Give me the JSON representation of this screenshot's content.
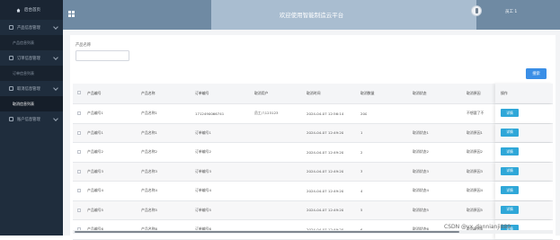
{
  "sidebar": {
    "home": "后台首页",
    "groups": [
      {
        "label": "产品信息管理",
        "sub": "产品信息列表"
      },
      {
        "label": "订单信息管理",
        "sub": "订单信息列表"
      },
      {
        "label": "取消信息管理",
        "sub": "取消信息列表"
      },
      {
        "label": "账户信息管理",
        "sub": ""
      }
    ]
  },
  "header": {
    "title": "欢迎使用智能制造云平台",
    "user": "员工 1"
  },
  "filter": {
    "label": "产品名称",
    "value": "",
    "search_label": "搜索"
  },
  "table": {
    "columns": [
      "产品编号",
      "产品名称",
      "订单编号",
      "取消用户",
      "取消时间",
      "取消数量",
      "取消状态",
      "取消原因",
      "操作"
    ],
    "rows": [
      [
        "产品编号1",
        "产品名称1",
        "1712490066741",
        "员工八123123",
        "2024-04-07 12:56:14",
        "200",
        "",
        "不想要了不",
        "详情"
      ],
      [
        "产品编号1",
        "产品名称1",
        "订单编号1",
        "",
        "2024-04-07 12:49:20",
        "1",
        "取消状态1",
        "取消原因1",
        "详情"
      ],
      [
        "产品编号2",
        "产品名称2",
        "订单编号2",
        "",
        "2024-04-07 12:49:20",
        "2",
        "取消状态2",
        "取消原因2",
        "详情"
      ],
      [
        "产品编号3",
        "产品名称3",
        "订单编号3",
        "",
        "2024-04-07 12:49:20",
        "3",
        "取消状态3",
        "取消原因3",
        "详情"
      ],
      [
        "产品编号4",
        "产品名称4",
        "订单编号4",
        "",
        "2024-04-07 12:49:20",
        "4",
        "取消状态4",
        "取消原因4",
        "详情"
      ],
      [
        "产品编号5",
        "产品名称5",
        "订单编号5",
        "",
        "2024-04-07 12:49:20",
        "5",
        "取消状态5",
        "取消原因5",
        "详情"
      ],
      [
        "产品编号6",
        "产品名称6",
        "订单编号6",
        "",
        "2024-04-07 12:49:20",
        "6",
        "取消状态6",
        "取消原因6",
        "详情"
      ]
    ]
  },
  "watermark": "CSDN @vx_dannianji889",
  "colors": {
    "sidebar": "#1f2d3d",
    "header": "#6f8aa3",
    "primary": "#3a8ee6",
    "detail_button": "#2fa7d8"
  }
}
